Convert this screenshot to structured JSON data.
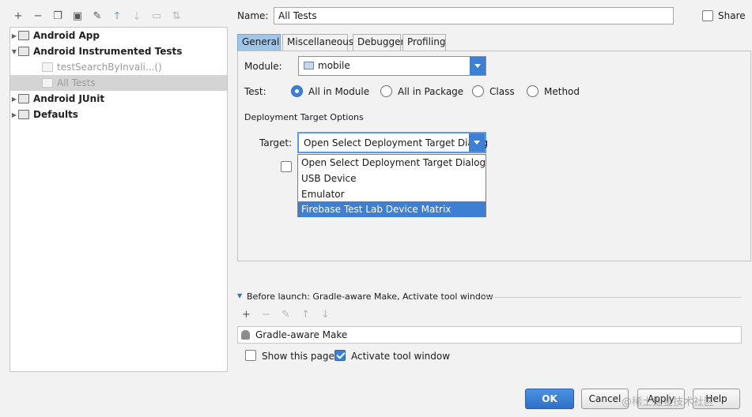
{
  "toolbar": {
    "icons": [
      {
        "name": "add-icon",
        "glyph": "+"
      },
      {
        "name": "remove-icon",
        "glyph": "−"
      },
      {
        "name": "copy-icon",
        "glyph": "❐"
      },
      {
        "name": "save-icon",
        "glyph": "▣"
      },
      {
        "name": "wrench-icon",
        "glyph": "✎"
      },
      {
        "name": "move-up-icon",
        "glyph": "🡑"
      },
      {
        "name": "move-down-icon",
        "glyph": "🡓"
      },
      {
        "name": "folder-icon",
        "glyph": "▭"
      },
      {
        "name": "sort-icon",
        "glyph": "⇅"
      }
    ]
  },
  "tree": {
    "items": [
      {
        "label": "Android App",
        "expanded": false
      },
      {
        "label": "Android Instrumented Tests",
        "expanded": true
      },
      {
        "label": "testSearchByInvali...()",
        "child": true
      },
      {
        "label": "All Tests",
        "child": true,
        "selected": true
      },
      {
        "label": "Android JUnit",
        "expanded": false
      },
      {
        "label": "Defaults",
        "expanded": false
      }
    ]
  },
  "config": {
    "name_label": "Name:",
    "name_value": "All Tests",
    "share_label": "Share",
    "tabs": [
      "General",
      "Miscellaneous",
      "Debugger",
      "Profiling"
    ],
    "active_tab": "General",
    "module_label": "Module:",
    "module_value": "mobile",
    "test_label": "Test:",
    "test_options": [
      "All in Module",
      "All in Package",
      "Class",
      "Method"
    ],
    "test_selected": "All in Module",
    "deployment_header": "Deployment Target Options",
    "target_label": "Target:",
    "target_value": "Open Select Deployment Target Dialog",
    "target_options": [
      "Open Select Deployment Target Dialog",
      "USB Device",
      "Emulator",
      "Firebase Test Lab Device Matrix"
    ],
    "target_highlighted": "Firebase Test Lab Device Matrix"
  },
  "before_launch": {
    "header": "Before launch: Gradle-aware Make, Activate tool window",
    "tools": [
      "add-icon",
      "remove-icon",
      "edit-icon",
      "up-icon",
      "down-icon"
    ],
    "items": [
      "Gradle-aware Make"
    ],
    "show_page_label": "Show this page",
    "show_page_checked": false,
    "activate_label": "Activate tool window",
    "activate_checked": true
  },
  "buttons": {
    "ok": "OK",
    "cancel": "Cancel",
    "apply": "Apply",
    "help": "Help"
  },
  "watermark": "@稀土掘金技术社区",
  "colors": {
    "accent": "#3d7fd3",
    "active_tab": "#9fc5e9",
    "selected_row": "#d4d4d4"
  }
}
